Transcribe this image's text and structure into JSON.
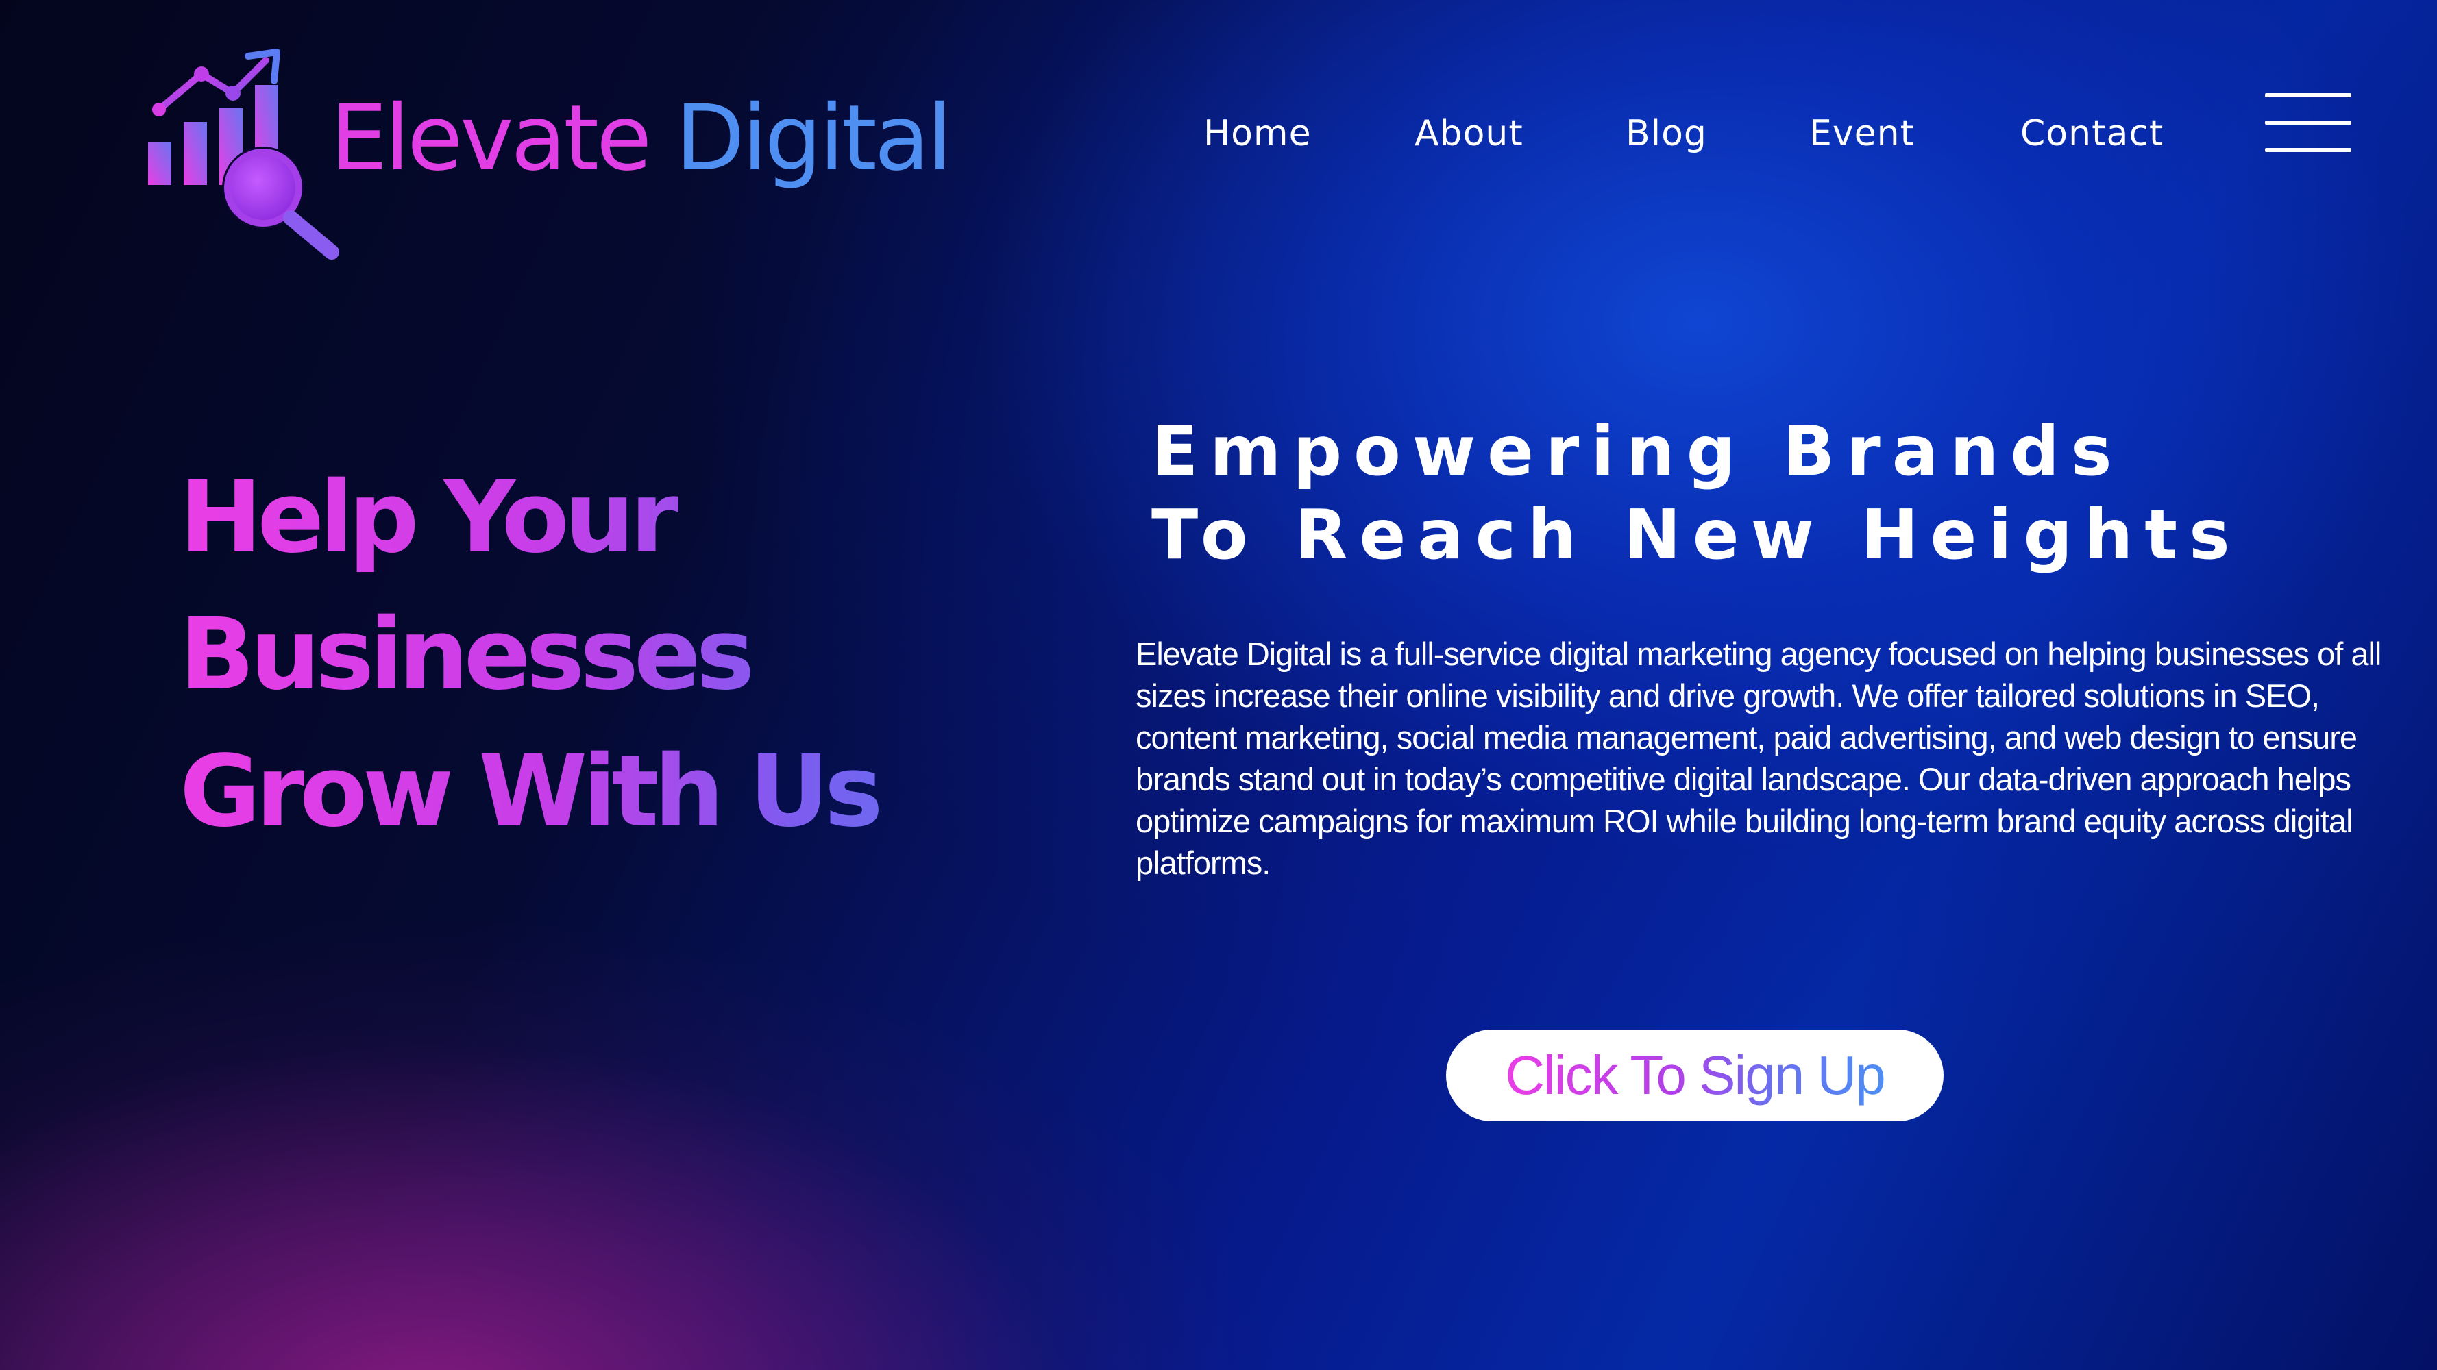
{
  "brand": {
    "word1": "Elevate",
    "word2": "Digital",
    "logo_icon": "growth-chart-magnifier-icon",
    "colors": {
      "pink": "#e13ee6",
      "purple": "#a63ee8",
      "blue": "#4f8ff2"
    }
  },
  "nav": {
    "items": [
      {
        "label": "Home"
      },
      {
        "label": "About"
      },
      {
        "label": "Blog"
      },
      {
        "label": "Event"
      },
      {
        "label": "Contact"
      }
    ],
    "menu_icon": "hamburger-menu-icon"
  },
  "hero": {
    "headline_lines": [
      "Help Your",
      "Businesses",
      "Grow With Us"
    ],
    "tagline_lines": [
      "Empowering Brands",
      "To Reach New Heights"
    ],
    "description": "Elevate Digital is a full-service digital marketing agency focused on helping businesses of all sizes increase their online visibility and drive growth. We offer tailored solutions in SEO, content marketing, social media management, paid advertising, and web design to ensure brands stand out in today’s competitive digital landscape. Our data-driven approach helps optimize campaigns for maximum ROI while building long-term brand equity across digital platforms.",
    "cta_label": "Click To Sign Up"
  },
  "theme": {
    "background_dark": "#04051d",
    "background_blue": "#0a3ac6",
    "background_magenta": "#8c1a84",
    "text_light": "#ffffff"
  }
}
